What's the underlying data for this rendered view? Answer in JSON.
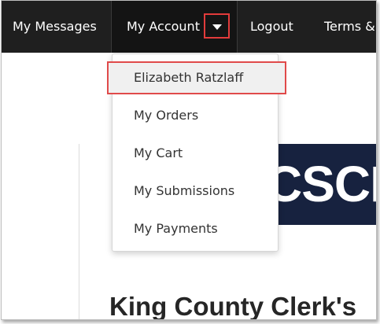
{
  "navbar": {
    "messages_label": "My Messages",
    "account_label": "My Account",
    "caret_icon": "caret-down-icon",
    "logout_label": "Logout",
    "terms_label": "Terms & C"
  },
  "dropdown": {
    "items": [
      {
        "label": "Elizabeth Ratzlaff"
      },
      {
        "label": "My Orders"
      },
      {
        "label": "My Cart"
      },
      {
        "label": "My Submissions"
      },
      {
        "label": "My Payments"
      }
    ]
  },
  "page": {
    "banner_text": "CSCF",
    "heading": "King County Clerk's"
  },
  "colors": {
    "navbar_bg": "#1f1f1f",
    "highlight_border": "#e23b3b",
    "banner_bg": "#17223f"
  }
}
